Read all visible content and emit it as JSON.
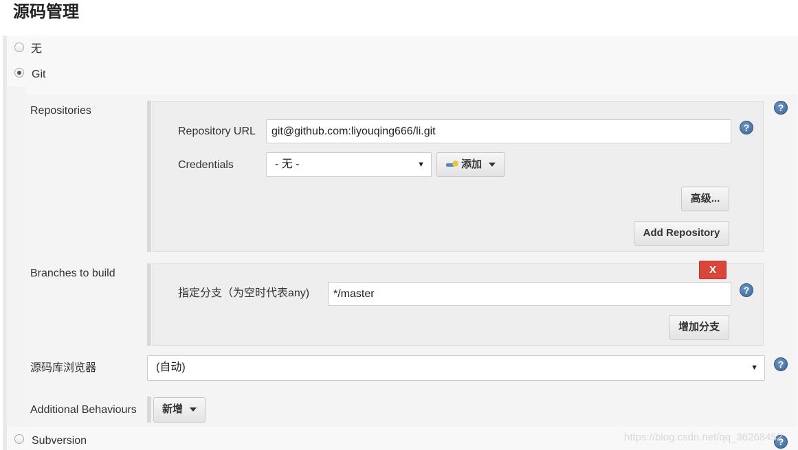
{
  "section": {
    "title": "源码管理"
  },
  "scm_options": {
    "none_label": "无",
    "git_label": "Git",
    "svn_label": "Subversion",
    "selected": "Git"
  },
  "git": {
    "repositories": {
      "label": "Repositories",
      "url_label": "Repository URL",
      "url_value": "git@github.com:liyouqing666/li.git",
      "credentials_label": "Credentials",
      "credentials_value": "- 无 -",
      "add_button": "添加",
      "advanced_button": "高级...",
      "add_repository_button": "Add Repository"
    },
    "branches": {
      "label": "Branches to build",
      "delete_button": "X",
      "branch_label": "指定分支（为空时代表any)",
      "branch_value": "*/master",
      "add_branch_button": "增加分支"
    },
    "browser": {
      "label": "源码库浏览器",
      "value": "(自动)"
    },
    "behaviours": {
      "label": "Additional Behaviours",
      "add_button": "新增"
    }
  },
  "help_icon_text": "?",
  "watermark": "https://blog.csdn.net/qq_36268452",
  "icons": {
    "help": "question-circle-icon",
    "credentials": "key-icon",
    "dropdown": "caret-down-icon"
  },
  "colors": {
    "delete": "#d9463a",
    "help": "#3b6698"
  }
}
